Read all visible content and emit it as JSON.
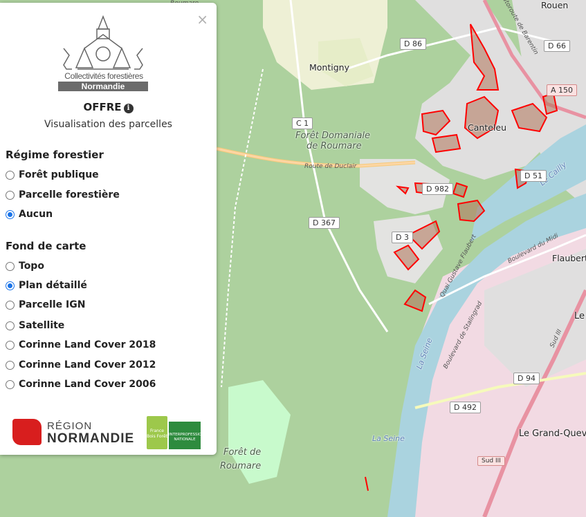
{
  "panel": {
    "close_glyph": "×",
    "logo_line1": "Collectivités forestières",
    "logo_line2": "Normandie",
    "title": "OFFRE",
    "info_glyph": "i",
    "subtitle": "Visualisation des parcelles",
    "regime": {
      "title": "Régime forestier",
      "options": [
        {
          "label": "Forêt publique",
          "checked": false
        },
        {
          "label": "Parcelle forestière",
          "checked": false
        },
        {
          "label": "Aucun",
          "checked": true
        }
      ]
    },
    "basemap": {
      "title": "Fond de carte",
      "options": [
        {
          "label": "Topo",
          "checked": false
        },
        {
          "label": "Plan détaillé",
          "checked": true
        },
        {
          "label": "Parcelle IGN",
          "checked": false
        },
        {
          "label": "Satellite",
          "checked": false
        },
        {
          "label": "Corinne Land Cover 2018",
          "checked": false
        },
        {
          "label": "Corinne Land Cover 2012",
          "checked": false
        },
        {
          "label": "Corinne Land Cover 2006",
          "checked": false
        }
      ]
    },
    "partner_region_line1": "RÉGION",
    "partner_region_line2": "NORMANDIE",
    "partner_fbf_line1": "France Bois Forêt",
    "partner_fbf_line2": "INTERPROFESSION NATIONALE"
  },
  "map": {
    "colors": {
      "forest": "#add19e",
      "urban": "#e0dfdf",
      "residential": "#f2dae3",
      "water": "#aad3df",
      "parcel_stroke": "#ff0000",
      "parcel_fill": "#b1755a"
    },
    "labels": {
      "montigny": "Montigny",
      "foret_domaniale": "Forêt Domaniale",
      "de_roumare": "de Roumare",
      "foret_de": "Forêt de",
      "roumare": "Roumare",
      "route_duclair": "Route de Duclair",
      "flaubert": "Flaubert",
      "le": "Le",
      "le_grand_quevilly": "Le Grand-Quev",
      "rouen": "Rouen",
      "roumare_top": "Roumare",
      "la_seine_1": "La Seine",
      "la_seine_2": "La Seine",
      "le_cailly": "Le Cailly",
      "quai_flaubert": "Quai Gustave Flaubert",
      "bd_stalingrad": "Boulevard de Stalingrad",
      "bd_midi": "Boulevard du Midi",
      "autoroute": "Autoroute de Barentin",
      "sud3": "Sud III",
      "canteleu": "Canteleu"
    },
    "shields": {
      "d86": "D 86",
      "d66": "D 66",
      "a150": "A 150",
      "c1": "C 1",
      "d982": "D 982",
      "d51": "D 51",
      "d367": "D 367",
      "d3": "D 3",
      "d94": "D 94",
      "d492": "D 492",
      "sud3_shield": "Sud III"
    }
  }
}
